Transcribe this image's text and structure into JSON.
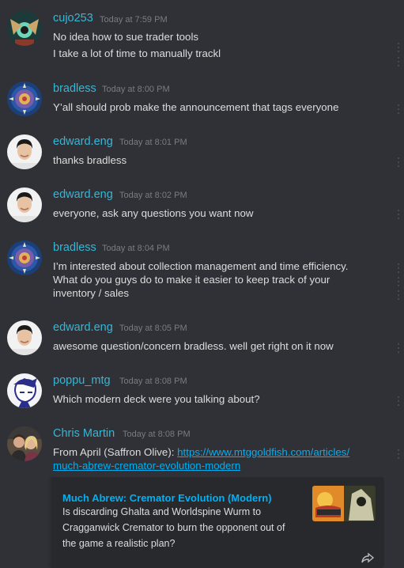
{
  "colors": {
    "background": "#2f3136",
    "username": "#37b6d6",
    "timestamp": "#787c83",
    "text": "#dcddde",
    "link": "#00b0f4"
  },
  "messages": [
    {
      "author": "cujo253",
      "time": "Today at 7:59 PM",
      "avatar": "art-avatar-icon",
      "lines": [
        "No idea how to sue trader tools",
        "I take a lot of time to manually trackl"
      ]
    },
    {
      "author": "bradless",
      "time": "Today at 8:00 PM",
      "avatar": "mosaic-avatar-icon",
      "lines": [
        "Y’all should prob make the announcement that tags everyone"
      ]
    },
    {
      "author": "edward.eng",
      "time": "Today at 8:01 PM",
      "avatar": "person-avatar-icon",
      "lines": [
        "thanks bradless"
      ]
    },
    {
      "author": "edward.eng",
      "time": "Today at 8:02 PM",
      "avatar": "person-avatar-icon",
      "lines": [
        "everyone, ask any questions you want now"
      ]
    },
    {
      "author": "bradless",
      "time": "Today at 8:04 PM",
      "avatar": "mosaic-avatar-icon",
      "lines": [
        "I’m interested about collection management and time efficiency.",
        "What do you guys do to make it easier to keep track of your",
        "inventory / sales"
      ]
    },
    {
      "author": "edward.eng",
      "time": "Today at 8:05 PM",
      "avatar": "person-avatar-icon",
      "lines": [
        "awesome question/concern bradless. well get right on it now"
      ]
    },
    {
      "author": "poppu_mtg",
      "time": "Today at 8:08 PM",
      "avatar": "cartoon-avatar-icon",
      "lines": [
        "Which modern deck were you talking about?"
      ]
    },
    {
      "author": "Chris Martin",
      "time": "Today at 8:08 PM",
      "avatar": "photo-avatar-icon",
      "prefix": "From April (Saffron Olive): ",
      "link_line1": "https://www.mtggoldfish.com/articles/",
      "link_line2": "much-abrew-cremator-evolution-modern"
    }
  ],
  "embed": {
    "title": "Much Abrew: Cremator Evolution (Modern)",
    "description": [
      "Is discarding Ghalta and Worldspine Wurm to",
      "Cragganwick Cremator to burn the opponent out of",
      "the game a realistic plan?"
    ],
    "thumbnail": "article-thumbnail"
  }
}
